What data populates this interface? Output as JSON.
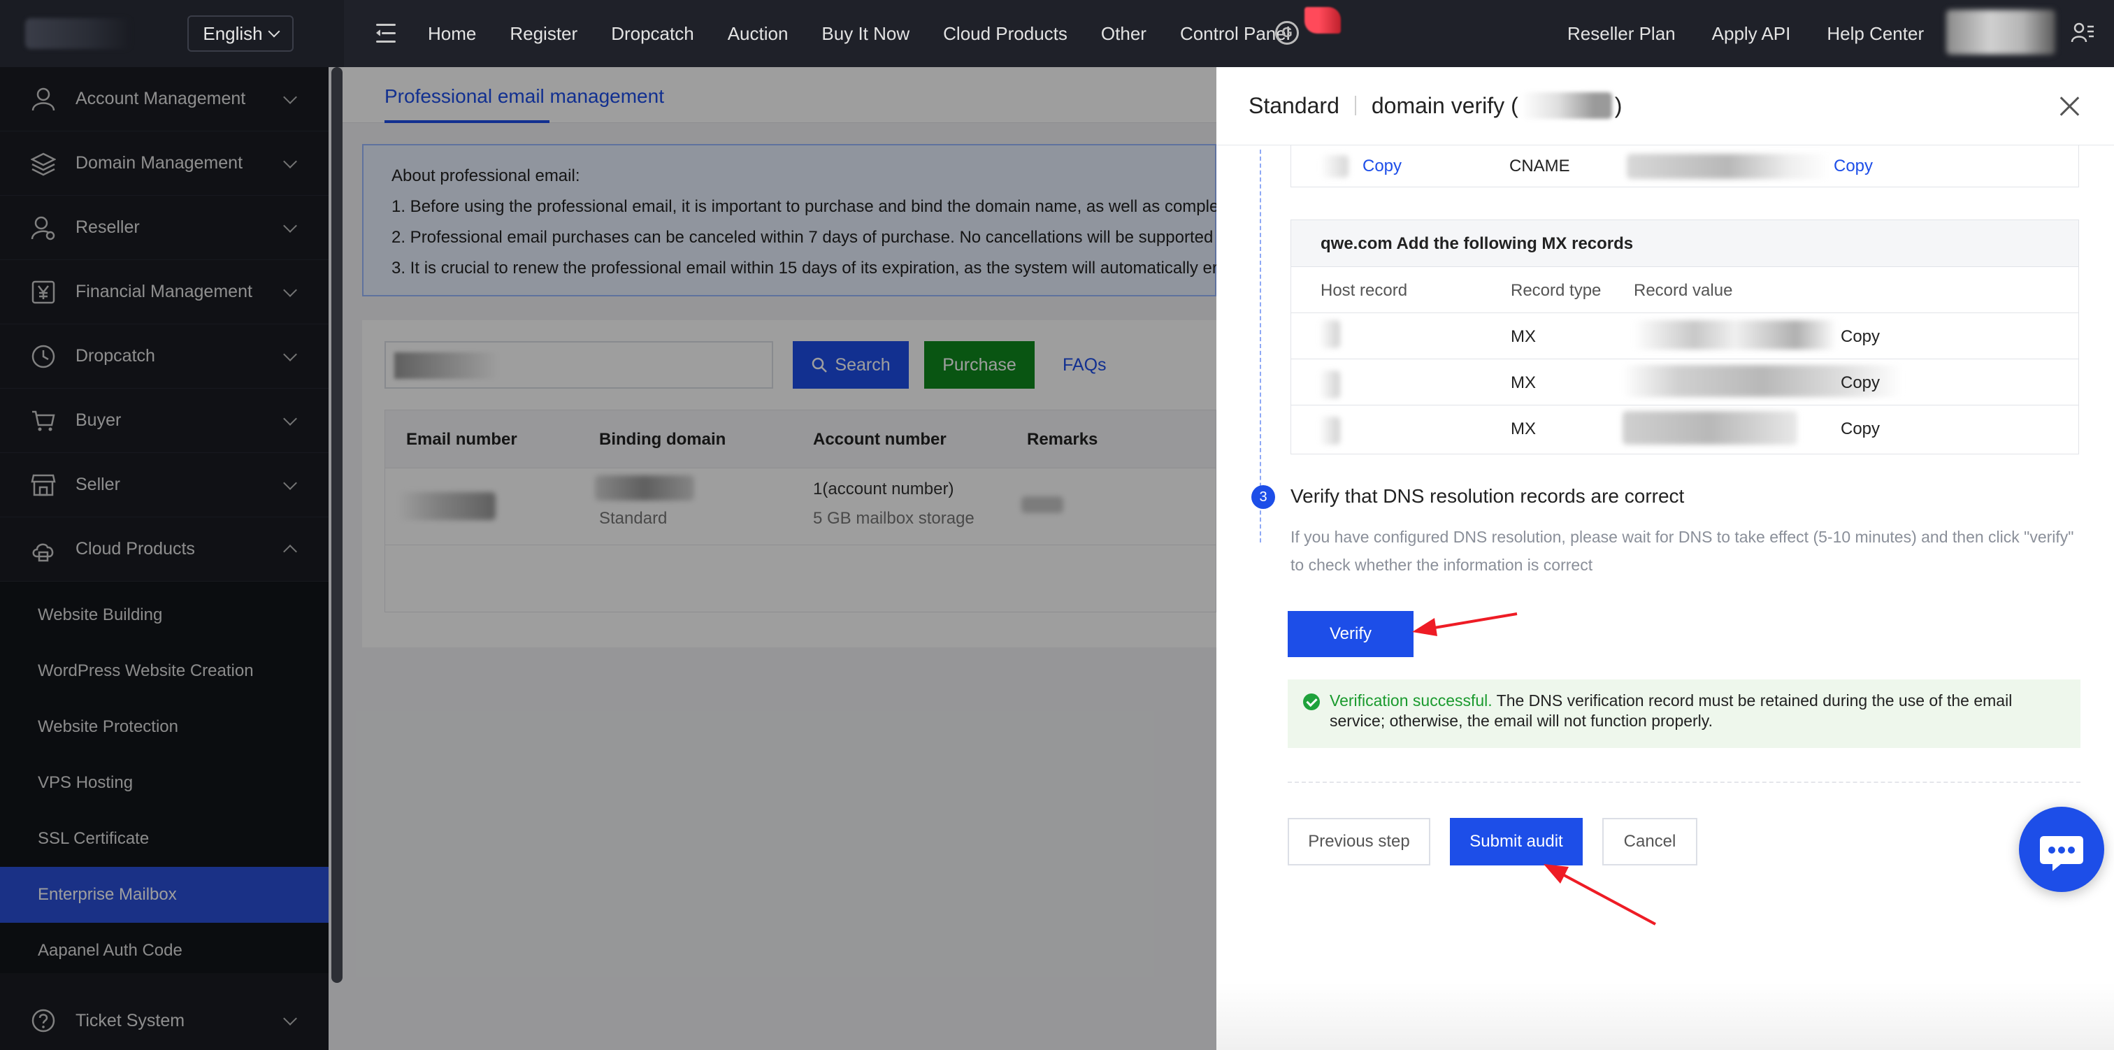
{
  "topbar": {
    "language": "English",
    "nav": [
      "Home",
      "Register",
      "Dropcatch",
      "Auction",
      "Buy It Now",
      "Cloud Products",
      "Other",
      "Control Panel"
    ],
    "nav_right": [
      "Reseller Plan",
      "Apply API",
      "Help Center"
    ],
    "g_icon_label": "G"
  },
  "sidebar": {
    "items": [
      {
        "label": "Account Management",
        "icon": "user-icon"
      },
      {
        "label": "Domain Management",
        "icon": "layers-icon"
      },
      {
        "label": "Reseller",
        "icon": "reseller-icon"
      },
      {
        "label": "Financial Management",
        "icon": "yen-icon"
      },
      {
        "label": "Dropcatch",
        "icon": "clock-icon"
      },
      {
        "label": "Buyer",
        "icon": "cart-icon"
      },
      {
        "label": "Seller",
        "icon": "store-icon"
      },
      {
        "label": "Cloud Products",
        "icon": "cloud-icon"
      }
    ],
    "sub_items": [
      "Website Building",
      "WordPress Website Creation",
      "Website Protection",
      "VPS Hosting",
      "SSL Certificate",
      "Enterprise Mailbox",
      "Aapanel Auth Code"
    ],
    "active_sub": "Enterprise Mailbox",
    "ticket": "Ticket System"
  },
  "main": {
    "tab": "Professional email management",
    "notice": [
      "About professional email:",
      "1. Before using the professional email, it is important to purchase and bind the domain name, as well as comple",
      "2. Professional email purchases can be canceled within 7 days of purchase. No cancellations will be supported",
      "3. It is crucial to renew the professional email within 15 days of its expiration, as the system will automatically er"
    ],
    "search_label": "Search",
    "purchase_label": "Purchase",
    "faqs_label": "FAQs",
    "columns": [
      "Email number",
      "Binding domain",
      "Account number",
      "Remarks"
    ],
    "row": {
      "plan": "Standard",
      "account": "1(account number)",
      "storage": "5 GB mailbox storage"
    }
  },
  "drawer": {
    "title_plan": "Standard",
    "title_main": "domain verify (",
    "title_close_paren": ")",
    "cname_row": {
      "copy1": "Copy",
      "type": "CNAME",
      "copy2": "Copy"
    },
    "mx_title": "qwe.com Add the following MX records",
    "mx_headers": [
      "Host record",
      "Record type",
      "Record value"
    ],
    "mx_rows": [
      {
        "type": "MX",
        "copy": "Copy"
      },
      {
        "type": "MX",
        "copy": "Copy"
      },
      {
        "type": "MX",
        "copy": "Copy"
      }
    ],
    "step_number": "3",
    "step_title": "Verify that DNS resolution records are correct",
    "step_desc": "If you have configured DNS resolution, please wait for DNS to take effect (5-10 minutes) and then click \"verify\" to check whether the information is correct",
    "verify_label": "Verify",
    "success_title": "Verification successful.",
    "success_msg": " The DNS verification record must be retained during the use of the email service; otherwise, the email will not function properly.",
    "prev_label": "Previous step",
    "submit_label": "Submit audit",
    "cancel_label": "Cancel"
  },
  "colors": {
    "primary": "#1d4ee8",
    "purchase": "#0f8a1e",
    "success": "#1a9a2e",
    "annotation_arrow": "#ee1c25"
  }
}
